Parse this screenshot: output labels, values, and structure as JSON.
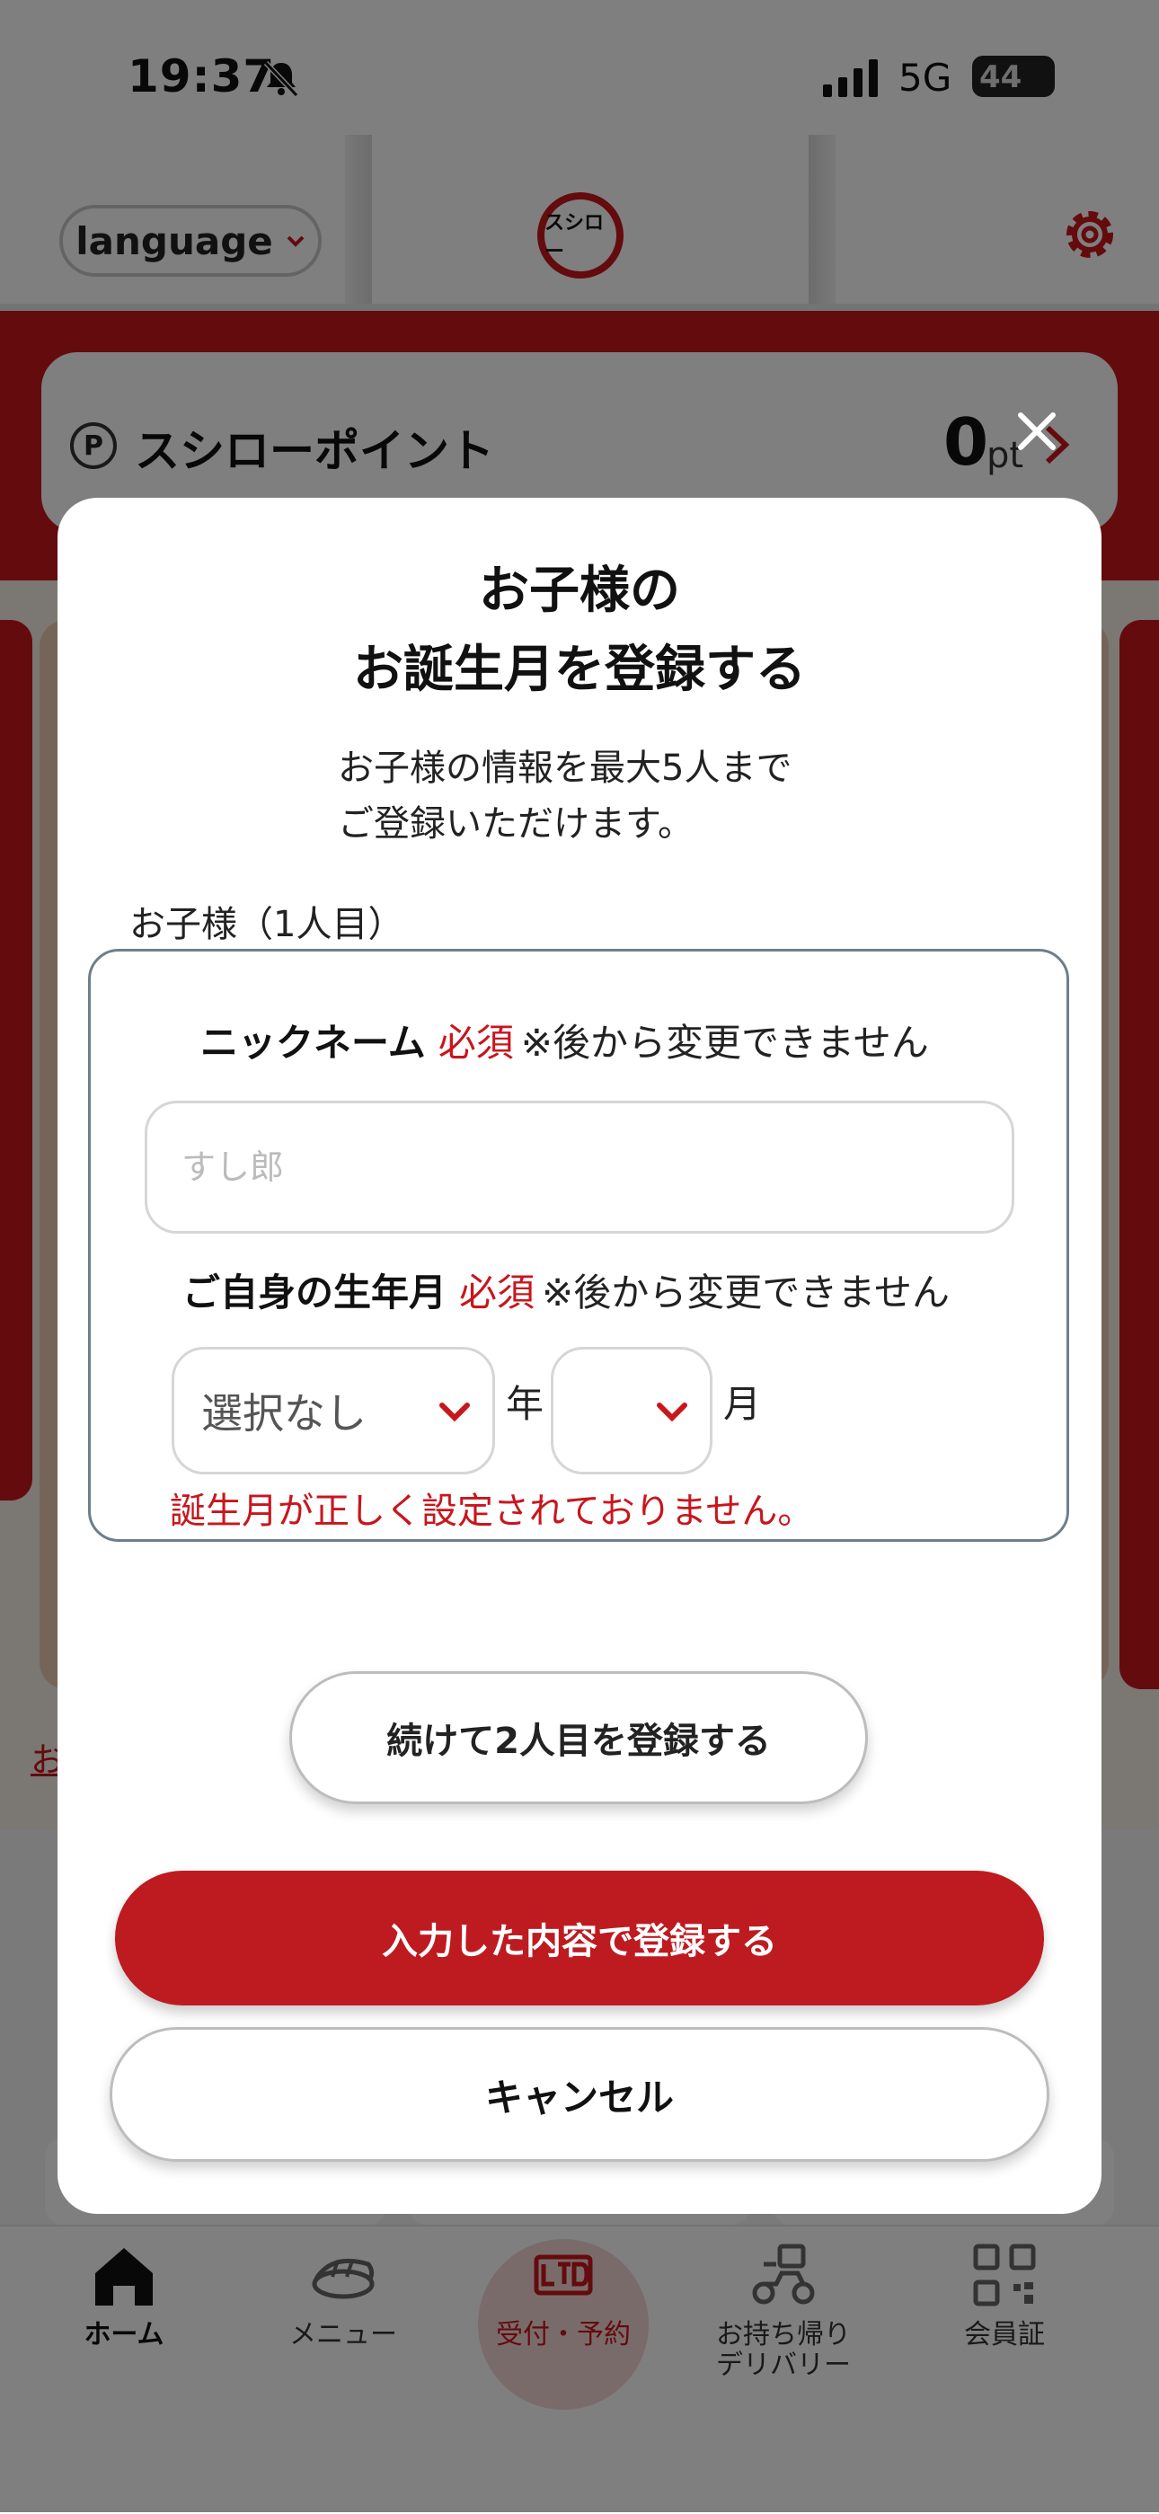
{
  "status_bar": {
    "time": "19:37",
    "network": "5G",
    "battery": "44"
  },
  "header": {
    "language_label": "language",
    "logo_text": "スシロー"
  },
  "points": {
    "title": "スシローポイント",
    "value": "0",
    "unit": "pt"
  },
  "banner": {
    "link_text": "お"
  },
  "tabs": [
    {
      "label": "ホーム",
      "icon": "home-icon"
    },
    {
      "label": "メニュー",
      "icon": "sushi-icon"
    },
    {
      "label": "受付・予約",
      "icon": "ltd-icon"
    },
    {
      "label": "お持ち帰り\nデリバリー",
      "label_line1": "お持ち帰り",
      "label_line2": "デリバリー",
      "icon": "scooter-icon"
    },
    {
      "label": "会員証",
      "icon": "qr-icon"
    }
  ],
  "modal": {
    "title_line1": "お子様の",
    "title_line2": "お誕生月を登録する",
    "desc_line1": "お子様の情報を最大5人まで",
    "desc_line2": "ご登録いただけます。",
    "child_label": "お子様（1人目）",
    "nickname": {
      "label": "ニックネーム",
      "required": "必須",
      "note": "※後から変更できません",
      "placeholder": "すし郎",
      "value": ""
    },
    "birth": {
      "label": "ご自身の生年月",
      "required": "必須",
      "note": "※後から変更できません",
      "year_value": "選択なし",
      "year_unit": "年",
      "month_value": "",
      "month_unit": "月",
      "error": "誕生月が正しく設定されておりません。"
    },
    "next_child_button": "続けて2人目を登録する",
    "submit_button": "入力した内容で登録する",
    "cancel_button": "キャンセル"
  },
  "colors": {
    "brand_red": "#c8161d",
    "submit_red": "#bd1b20",
    "card_border": "#6c7f8b"
  }
}
